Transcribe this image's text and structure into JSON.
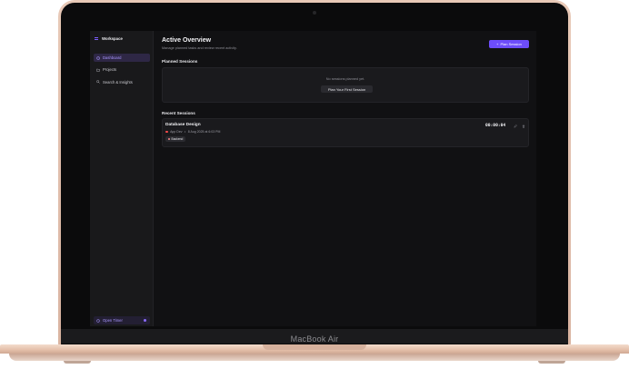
{
  "device": {
    "label": "MacBook Air"
  },
  "sidebar": {
    "workspace_label": "Workspace",
    "items": [
      {
        "label": "Dashboard",
        "icon": "dashboard-icon",
        "active": true
      },
      {
        "label": "Projects",
        "icon": "folder-icon",
        "active": false
      },
      {
        "label": "Search & Insights",
        "icon": "search-icon",
        "active": false
      }
    ],
    "timer_label": "Open Timer"
  },
  "header": {
    "title": "Active Overview",
    "subtitle": "Manage planned tasks and review recent activity.",
    "plan_button_label": "Plan Session"
  },
  "planned": {
    "title": "Planned Sessions",
    "empty_text": "No sessions planned yet.",
    "button_label": "Plan Your First Session"
  },
  "recent": {
    "title": "Recent Sessions",
    "sessions": [
      {
        "name": "Database Design",
        "app": "App Dev",
        "separator": "•",
        "date": "8 Aug 2025 at 6:03 PM",
        "tag": "Backend",
        "duration": "00:00:04"
      }
    ]
  },
  "colors": {
    "accent": "#6d4dfb",
    "accent_text": "#a996ff",
    "status_dot": "#ff4b4b",
    "background": "#111113",
    "surface": "#1a1a1d"
  }
}
